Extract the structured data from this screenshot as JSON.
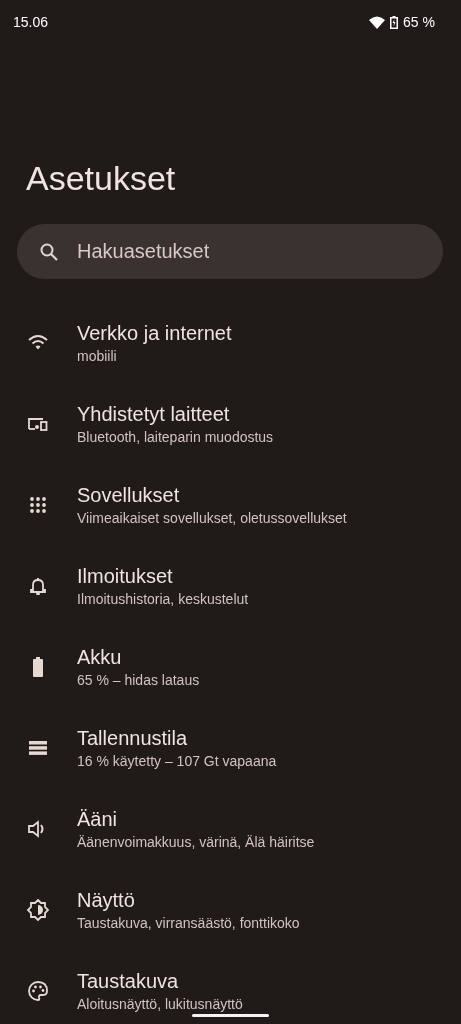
{
  "status_bar": {
    "time": "15.06",
    "battery": "65 %"
  },
  "title": "Asetukset",
  "search": {
    "placeholder": "Hakuasetukset"
  },
  "items": [
    {
      "kind": "wifi",
      "title": "Verkko ja internet",
      "subtitle": "mobiili"
    },
    {
      "kind": "devices",
      "title": "Yhdistetyt laitteet",
      "subtitle": "Bluetooth, laiteparin muodostus"
    },
    {
      "kind": "apps",
      "title": "Sovellukset",
      "subtitle": "Viimeaikaiset sovellukset, oletussovellukset"
    },
    {
      "kind": "bell",
      "title": "Ilmoitukset",
      "subtitle": "Ilmoitushistoria, keskustelut"
    },
    {
      "kind": "battery",
      "title": "Akku",
      "subtitle": "65 % – hidas lataus"
    },
    {
      "kind": "storage",
      "title": "Tallennustila",
      "subtitle": "16 % käytetty – 107 Gt vapaana"
    },
    {
      "kind": "sound",
      "title": "Ääni",
      "subtitle": "Äänenvoimakkuus, värinä, Älä häiritse"
    },
    {
      "kind": "display",
      "title": "Näyttö",
      "subtitle": "Taustakuva, virransäästö, fonttikoko"
    },
    {
      "kind": "palette",
      "title": "Taustakuva",
      "subtitle": "Aloitusnäyttö, lukitusnäyttö"
    }
  ]
}
